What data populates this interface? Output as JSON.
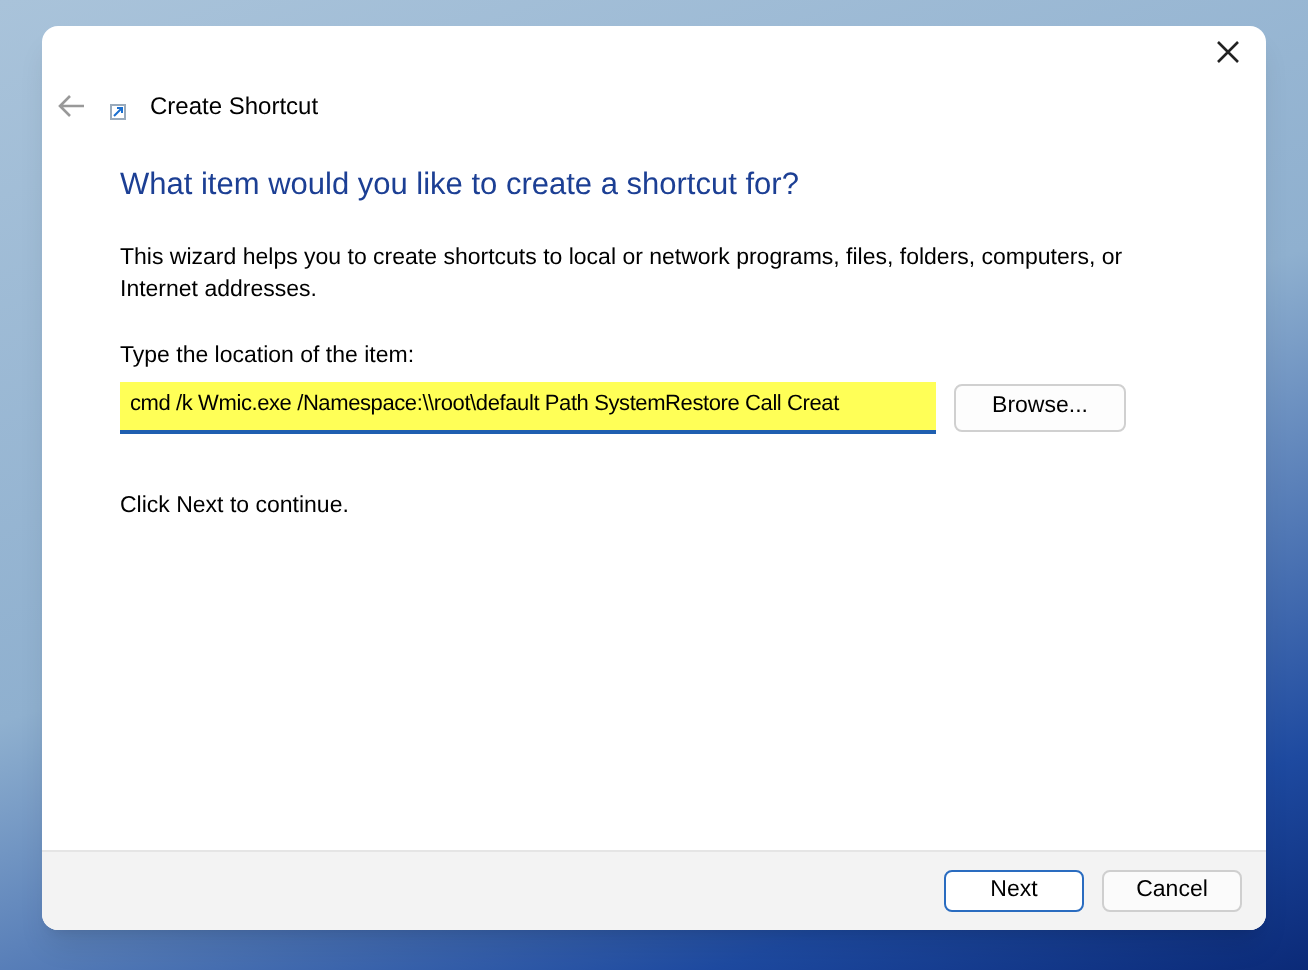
{
  "window": {
    "title": "Create Shortcut"
  },
  "heading": "What item would you like to create a shortcut for?",
  "description": "This wizard helps you to create shortcuts to local or network programs, files, folders, computers, or Internet addresses.",
  "location": {
    "label": "Type the location of the item:",
    "value": "cmd /k Wmic.exe /Namespace:\\\\root\\default Path SystemRestore Call Creat",
    "browse": "Browse..."
  },
  "hint": "Click Next to continue.",
  "buttons": [
    {
      "label": "Next",
      "default": true
    },
    {
      "label": "Cancel",
      "default": false
    }
  ]
}
